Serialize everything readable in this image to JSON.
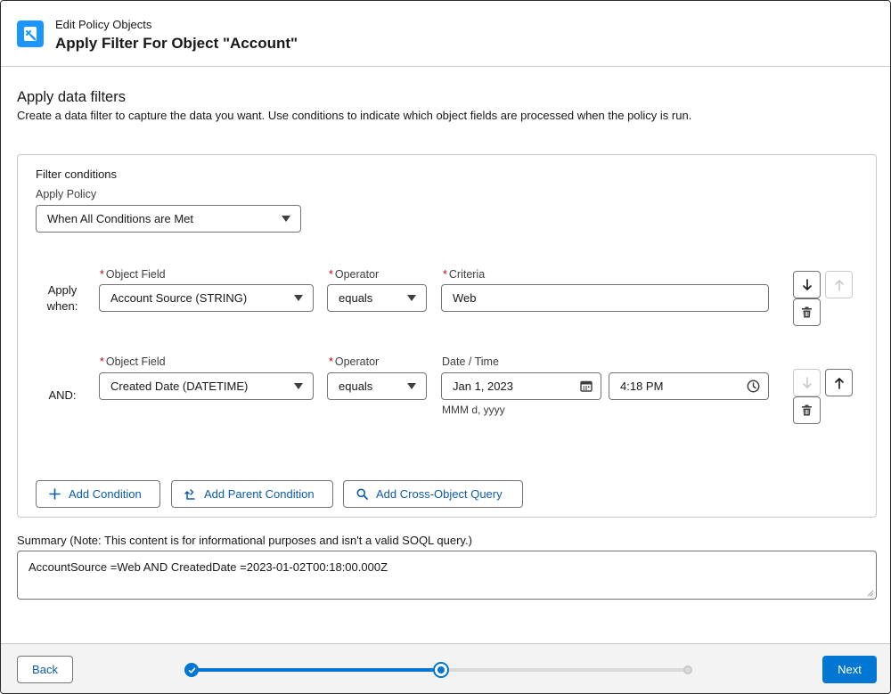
{
  "header": {
    "eyebrow": "Edit Policy Objects",
    "title": "Apply Filter For Object \"Account\""
  },
  "section": {
    "title": "Apply data filters",
    "description": "Create a data filter to capture the data you want. Use conditions to indicate which object fields are processed when the policy is run."
  },
  "filter": {
    "heading": "Filter conditions",
    "apply_policy_label": "Apply Policy",
    "apply_policy_value": "When All Conditions are Met",
    "conditions": [
      {
        "row_label_line1": "Apply",
        "row_label_line2": "when:",
        "field_label": "Object Field",
        "field_value": "Account Source (STRING)",
        "operator_label": "Operator",
        "operator_value": "equals",
        "criteria_label": "Criteria",
        "criteria_value": "Web"
      },
      {
        "row_label": "AND:",
        "field_label": "Object Field",
        "field_value": "Created Date (DATETIME)",
        "operator_label": "Operator",
        "operator_value": "equals",
        "datetime_label": "Date / Time",
        "date_value": "Jan 1, 2023",
        "time_value": "4:18 PM",
        "date_format_hint": "MMM d, yyyy"
      }
    ],
    "required_marker": "*",
    "actions": {
      "add_condition": "Add Condition",
      "add_parent_condition": "Add Parent Condition",
      "add_cross_object_query": "Add Cross-Object Query"
    }
  },
  "summary": {
    "label": "Summary (Note: This content is for informational purposes and isn't a valid SOQL query.)",
    "value": "AccountSource =Web AND CreatedDate =2023-01-02T00:18:00.000Z"
  },
  "footer": {
    "back_label": "Back",
    "next_label": "Next",
    "progress": {
      "current_step": 2,
      "total_steps": 3
    }
  },
  "colors": {
    "brand": "#0176d3",
    "link": "#0b5cab",
    "required": "#ba0517",
    "icon_tile": "#1b96ff"
  },
  "icons": [
    "policy-object-icon",
    "chevron-down-icon",
    "arrow-down-icon",
    "arrow-up-icon",
    "delete-icon",
    "calendar-icon",
    "clock-icon",
    "add-icon",
    "add-parent-icon",
    "search-icon",
    "check-icon",
    "resize-grip-icon"
  ]
}
